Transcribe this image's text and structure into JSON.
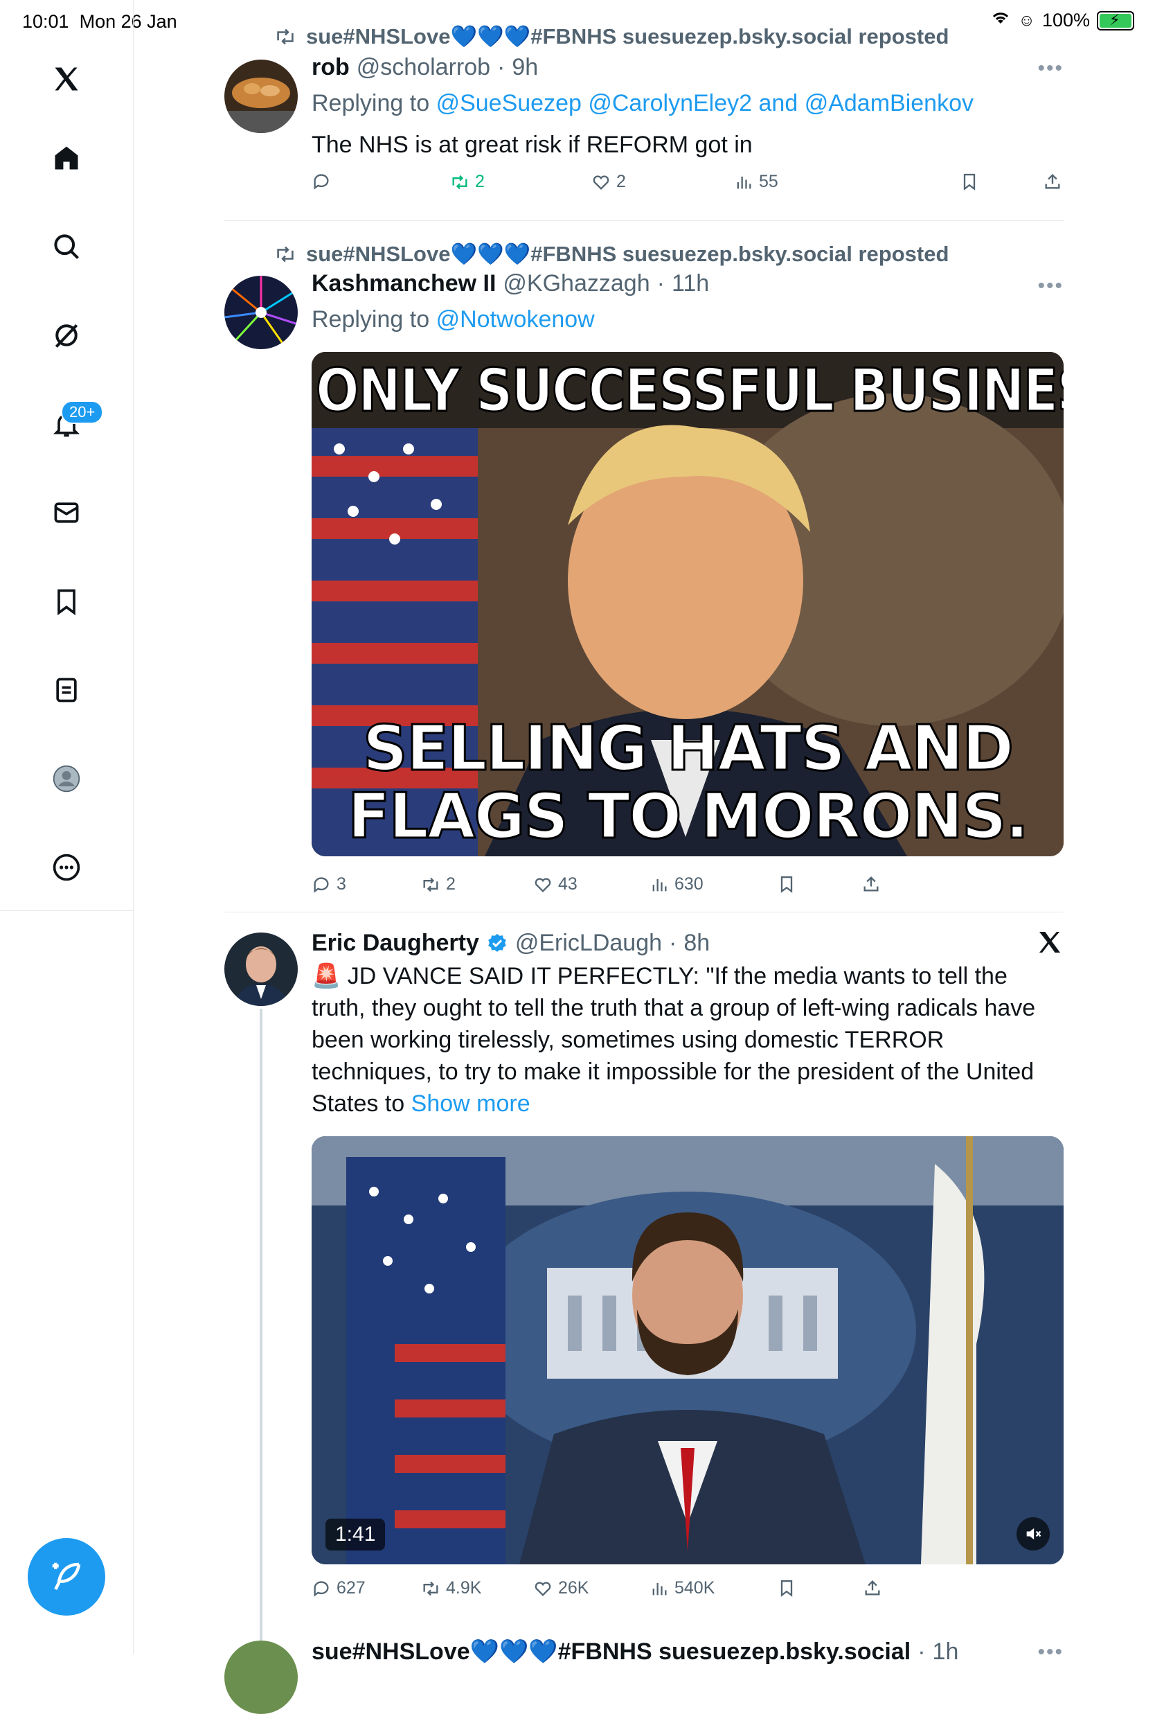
{
  "status_bar": {
    "time": "10:01",
    "date": "Mon 26 Jan",
    "battery": "100%"
  },
  "sidebar": {
    "items": [
      {
        "name": "x-logo"
      },
      {
        "name": "home"
      },
      {
        "name": "search"
      },
      {
        "name": "grok"
      },
      {
        "name": "notifications",
        "badge": "20+"
      },
      {
        "name": "messages"
      },
      {
        "name": "bookmarks"
      },
      {
        "name": "lists"
      },
      {
        "name": "profile"
      },
      {
        "name": "more"
      }
    ],
    "accent": "#1d9bf0"
  },
  "tweets": [
    {
      "repost_by": "sue#NHSLove💙💙💙#FBNHS suesuezep.bsky.social reposted",
      "name": "rob",
      "handle": "@scholarrob",
      "time": "9h",
      "reply_prefix": "Replying to",
      "mentions": "@SueSuezep @CarolynEley2",
      "reply_and": "and",
      "mention_last": "@AdamBienkov",
      "text": "The NHS is at great risk if REFORM got in",
      "replies": "",
      "reposts": "2",
      "likes": "2",
      "views": "55"
    },
    {
      "repost_by": "sue#NHSLove💙💙💙#FBNHS suesuezep.bsky.social reposted",
      "name": "Kashmanchew II",
      "handle": "@KGhazzagh",
      "time": "11h",
      "reply_prefix": "Replying to",
      "mentions": "@Notwokenow",
      "meme_top": "ONLY SUCCESSFUL BUSINESS...",
      "meme_bottom_1": "SELLING HATS AND",
      "meme_bottom_2": "FLAGS TO MORONS.",
      "replies": "3",
      "reposts": "2",
      "likes": "43",
      "views": "630"
    },
    {
      "name": "Eric Daugherty",
      "handle": "@EricLDaugh",
      "time": "8h",
      "text": "🚨 JD VANCE SAID IT PERFECTLY: \"If the media wants to tell the truth, they ought to tell the truth that a group of left-wing radicals have been working tirelessly, sometimes using domestic TERROR techniques, to try to make it impossible for the president of the United States to",
      "show_more": "Show more",
      "video_duration": "1:41",
      "replies": "627",
      "reposts": "4.9K",
      "likes": "26K",
      "views": "540K"
    },
    {
      "repost_by": "sue#NHSLove💙💙💙#FBNHS suesuezep.bsky.social",
      "time": "1h"
    }
  ]
}
